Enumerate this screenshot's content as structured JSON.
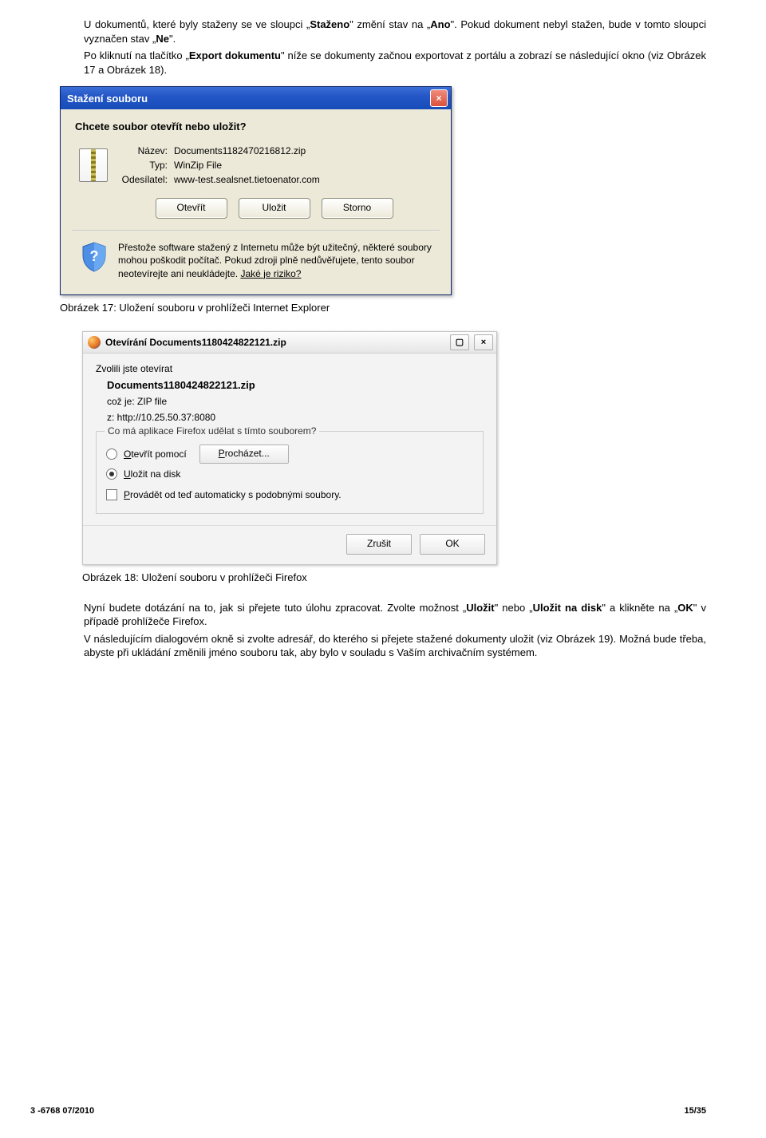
{
  "para1_a": "U dokumentů, které byly staženy se ve sloupci „",
  "para1_b": "Staženo",
  "para1_c": "\" změní stav na „",
  "para1_d": "Ano",
  "para1_e": "\". Pokud dokument nebyl stažen, bude v tomto sloupci vyznačen stav „",
  "para1_f": "Ne",
  "para1_g": "\".",
  "para2_a": "Po kliknutí na tlačítko „",
  "para2_b": "Export dokumentu",
  "para2_c": "\" níže se dokumenty začnou exportovat z portálu a zobrazí se následující okno (viz Obrázek 17 a Obrázek 18).",
  "ie": {
    "title": "Stažení souboru",
    "question": "Chcete soubor otevřít nebo uložit?",
    "name_label": "Název:",
    "name_value": "Documents1182470216812.zip",
    "type_label": "Typ:",
    "type_value": "WinZip File",
    "from_label": "Odesílatel:",
    "from_value": "www-test.sealsnet.tietoenator.com",
    "btn_open": "Otevřít",
    "btn_save": "Uložit",
    "btn_cancel": "Storno",
    "warn": "Přestože software stažený z Internetu může být užitečný, některé soubory mohou poškodit počítač. Pokud zdroji plně nedůvěřujete, tento soubor neotevírejte ani neukládejte. ",
    "warn_link": "Jaké je riziko?"
  },
  "caption17": "Obrázek 17: Uložení souboru v prohlížeči Internet Explorer",
  "ff": {
    "title": "Otevírání Documents1180424822121.zip",
    "intro": "Zvolili jste otevírat",
    "filename": "Documents1180424822121.zip",
    "type_line": "což je: ZIP file",
    "from_line": "z:  http://10.25.50.37:8080",
    "legend": "Co má aplikace Firefox udělat s tímto souborem?",
    "open_a": "O",
    "open_b": "tevřít pomocí",
    "browse_a": "P",
    "browse_b": "rocházet...",
    "save_a": "U",
    "save_b": "ložit na disk",
    "auto_a": "P",
    "auto_b": "rovádět od teď automaticky s podobnými soubory.",
    "btn_cancel": "Zrušit",
    "btn_ok": "OK"
  },
  "caption18": "Obrázek 18: Uložení souboru v prohlížeči Firefox",
  "para3_a": "Nyní budete dotázání na to, jak si přejete tuto úlohu zpracovat. Zvolte možnost „",
  "para3_b": "Uložit",
  "para3_c": "\" nebo „",
  "para3_d": "Uložit na disk",
  "para3_e": "\" a klikněte na „",
  "para3_f": "OK",
  "para3_g": "\" v případě prohlížeče Firefox.",
  "para4": "V následujícím dialogovém okně si zvolte adresář, do kterého si přejete stažené dokumenty uložit (viz Obrázek 19). Možná bude třeba, abyste při ukládání změnili jméno souboru tak, aby bylo v souladu s Vaším archivačním systémem.",
  "footer_left": "3 -6768 07/2010",
  "footer_right": "15/35"
}
